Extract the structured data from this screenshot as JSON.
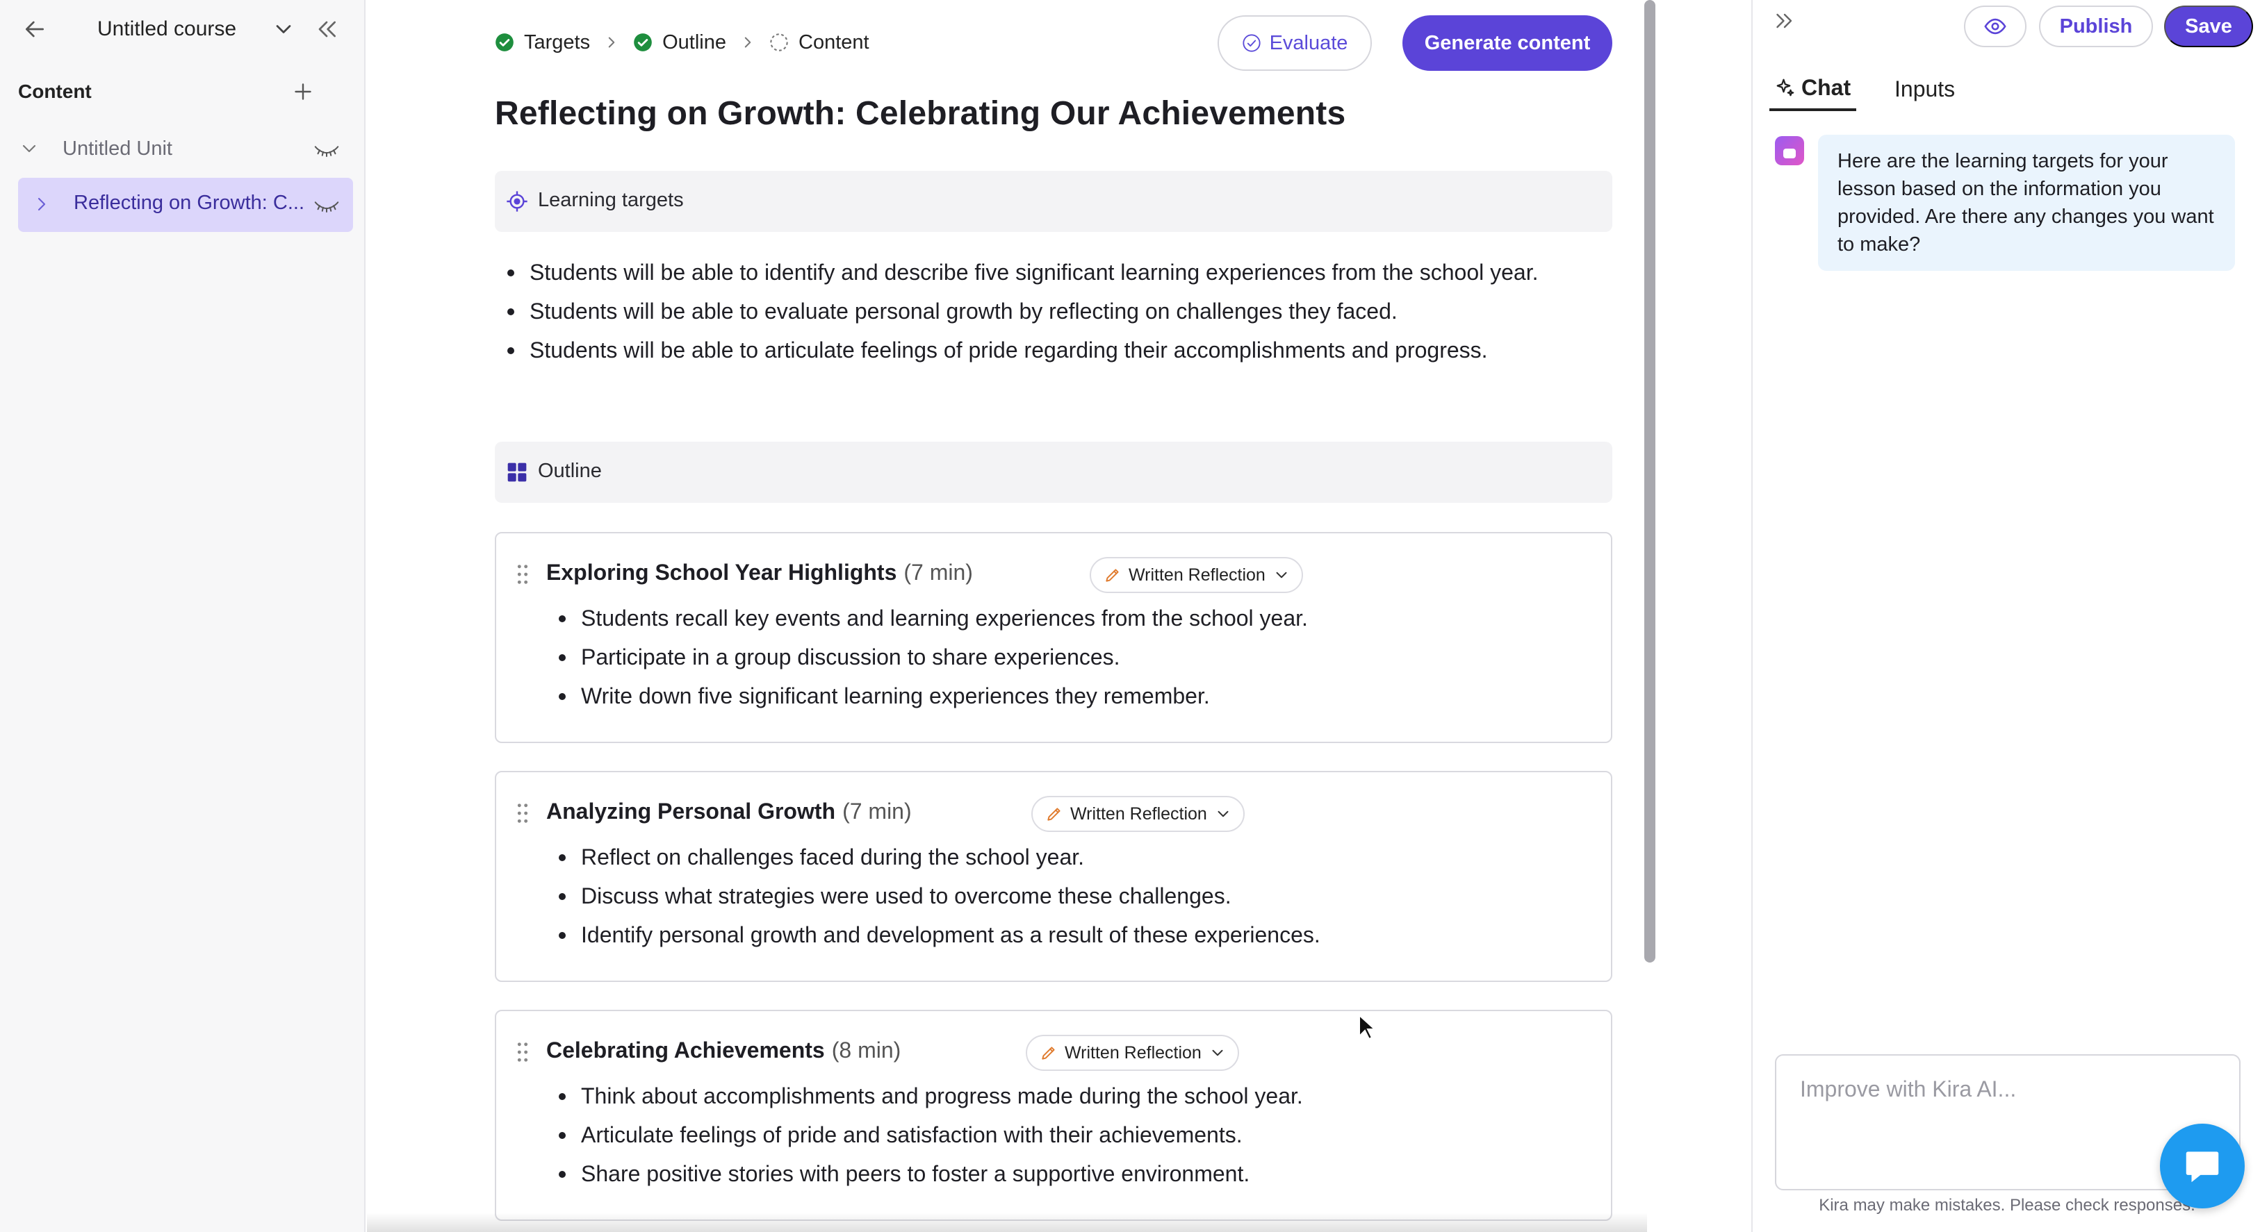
{
  "sidebar": {
    "course_title": "Untitled course",
    "content_label": "Content",
    "unit_label": "Untitled Unit",
    "lesson_label": "Reflecting on Growth: C..."
  },
  "header": {
    "breadcrumbs": [
      {
        "label": "Targets",
        "status": "done"
      },
      {
        "label": "Outline",
        "status": "done"
      },
      {
        "label": "Content",
        "status": "pending"
      }
    ],
    "evaluate_label": "Evaluate",
    "generate_label": "Generate content"
  },
  "main": {
    "title": "Reflecting on Growth: Celebrating Our Achievements",
    "targets_heading": "Learning targets",
    "targets": [
      "Students will be able to identify and describe five significant learning experiences from the school year.",
      "Students will be able to evaluate personal growth by reflecting on challenges they faced.",
      "Students will be able to articulate feelings of pride regarding their accomplishments and progress."
    ],
    "outline_heading": "Outline",
    "sections": [
      {
        "title": "Exploring School Year Highlights",
        "duration": "(7 min)",
        "type": "Written Reflection",
        "bullets": [
          "Students recall key events and learning experiences from the school year.",
          "Participate in a group discussion to share experiences.",
          "Write down five significant learning experiences they remember."
        ]
      },
      {
        "title": "Analyzing Personal Growth",
        "duration": "(7 min)",
        "type": "Written Reflection",
        "bullets": [
          "Reflect on challenges faced during the school year.",
          "Discuss what strategies were used to overcome these challenges.",
          "Identify personal growth and development as a result of these experiences."
        ]
      },
      {
        "title": "Celebrating Achievements",
        "duration": "(8 min)",
        "type": "Written Reflection",
        "bullets": [
          "Think about accomplishments and progress made during the school year.",
          "Articulate feelings of pride and satisfaction with their achievements.",
          "Share positive stories with peers to foster a supportive environment."
        ]
      }
    ]
  },
  "right_panel": {
    "publish_label": "Publish",
    "save_label": "Save",
    "tabs": [
      {
        "label": "Chat",
        "active": true
      },
      {
        "label": "Inputs",
        "active": false
      }
    ],
    "message": "Here are the learning targets for your lesson based on the information you provided. Are there any changes you want to make?",
    "input_placeholder": "Improve with Kira AI...",
    "disclaimer": "Kira may make mistakes. Please check responses."
  },
  "colors": {
    "accent": "#5b44d8",
    "done": "#1e8e3e",
    "selected_bg": "#dcd6fb",
    "bubble_bg": "#eaf4fd",
    "fab": "#1e9bf0"
  }
}
